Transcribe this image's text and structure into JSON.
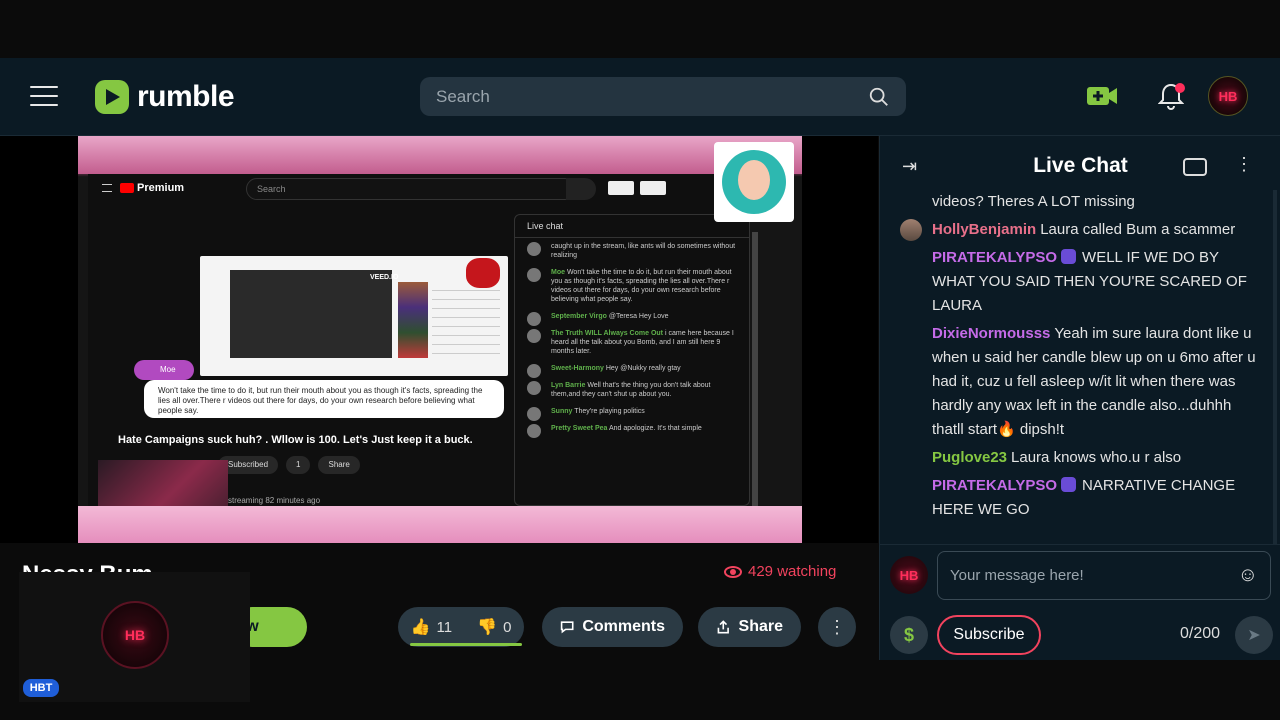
{
  "header": {
    "logo_text": "rumble",
    "search_placeholder": "Search",
    "accent_color": "#85c742",
    "notification_dot_color": "#ff2e5b",
    "avatar_mark": "HB"
  },
  "stream": {
    "inner_yt": {
      "brand": "Premium",
      "search_placeholder": "Search",
      "screen_tag": "VEED.IO",
      "bubble_user": "Moe",
      "bubble_text": "Won't take the time to do it, but run their mouth about you as though it's facts, spreading the lies all over.There r videos out there for days, do your own research before believing what people say.",
      "caption": "Hate Campaigns suck huh? . Wllow is 100. Let's Just keep it a buck.",
      "subscribed_label": "Subscribed",
      "like_count": "1",
      "share_label": "Share",
      "streaming_text": "streaming 82 minutes ago",
      "chat_header": "Live chat",
      "chat_messages": [
        {
          "user": "",
          "text": "caught up in the stream, like ants will do sometimes without realizing"
        },
        {
          "user": "Moe",
          "text": "Won't take the time to do it, but run their mouth about you as though it's facts, spreading the lies all over.There r videos out there for days, do your own research before believing what people say."
        },
        {
          "user": "September Virgo",
          "text": "@Teresa Hey Love"
        },
        {
          "user": "The Truth WILL Always Come Out",
          "text": "i came here because I heard all the talk about you Bomb, and I am still here 9 months later."
        },
        {
          "user": "Sweet-Harmony",
          "text": "Hey @Nukky really gtay"
        },
        {
          "user": "Lyn Barrie",
          "text": "Well that's the thing you don't talk about them,and they can't shut up about you."
        },
        {
          "user": "Sunny",
          "text": "They're playing politics"
        },
        {
          "user": "Pretty Sweet Pea",
          "text": "And apologize. It's that simple"
        }
      ]
    }
  },
  "video": {
    "title": "Nessy Bum",
    "watching": "429 watching",
    "follow_label": "Follow",
    "channel_badge": "HBT",
    "likes": "11",
    "dislikes": "0",
    "comments_label": "Comments",
    "share_label": "Share",
    "more_icon": "kebab-icon"
  },
  "chat": {
    "title": "Live Chat",
    "messages": [
      {
        "user": "",
        "color": "#e4e4e4",
        "text": "videos? Theres A LOT missing",
        "avatar": false,
        "badge": false
      },
      {
        "user": "HollyBenjamin",
        "color": "#e8708a",
        "text": "Laura called Bum a scammer",
        "avatar": true,
        "badge": false
      },
      {
        "user": "PIRATEKALYPSO",
        "color": "#c56be8",
        "text": "WELL IF WE DO BY WHAT YOU SAID THEN YOU'RE SCARED OF LAURA",
        "avatar": false,
        "badge": true
      },
      {
        "user": "DixieNormousss",
        "color": "#c56be8",
        "text": "Yeah im sure laura dont like u when u said her candle blew up on u 6mo after u had it, cuz u fell asleep w/it lit when there was hardly any wax left in the candle also...duhhh thatll start🔥 dipsh!t",
        "avatar": false,
        "badge": false
      },
      {
        "user": "Puglove23",
        "color": "#85c742",
        "text": "Laura knows who.u r also",
        "avatar": false,
        "badge": false
      },
      {
        "user": "PIRATEKALYPSO",
        "color": "#c56be8",
        "text": "NARRATIVE CHANGE HERE WE GO",
        "avatar": false,
        "badge": true
      }
    ],
    "input_placeholder": "Your message here!",
    "subscribe_label": "Subscribe",
    "counter": "0/200",
    "tip_symbol": "$"
  }
}
